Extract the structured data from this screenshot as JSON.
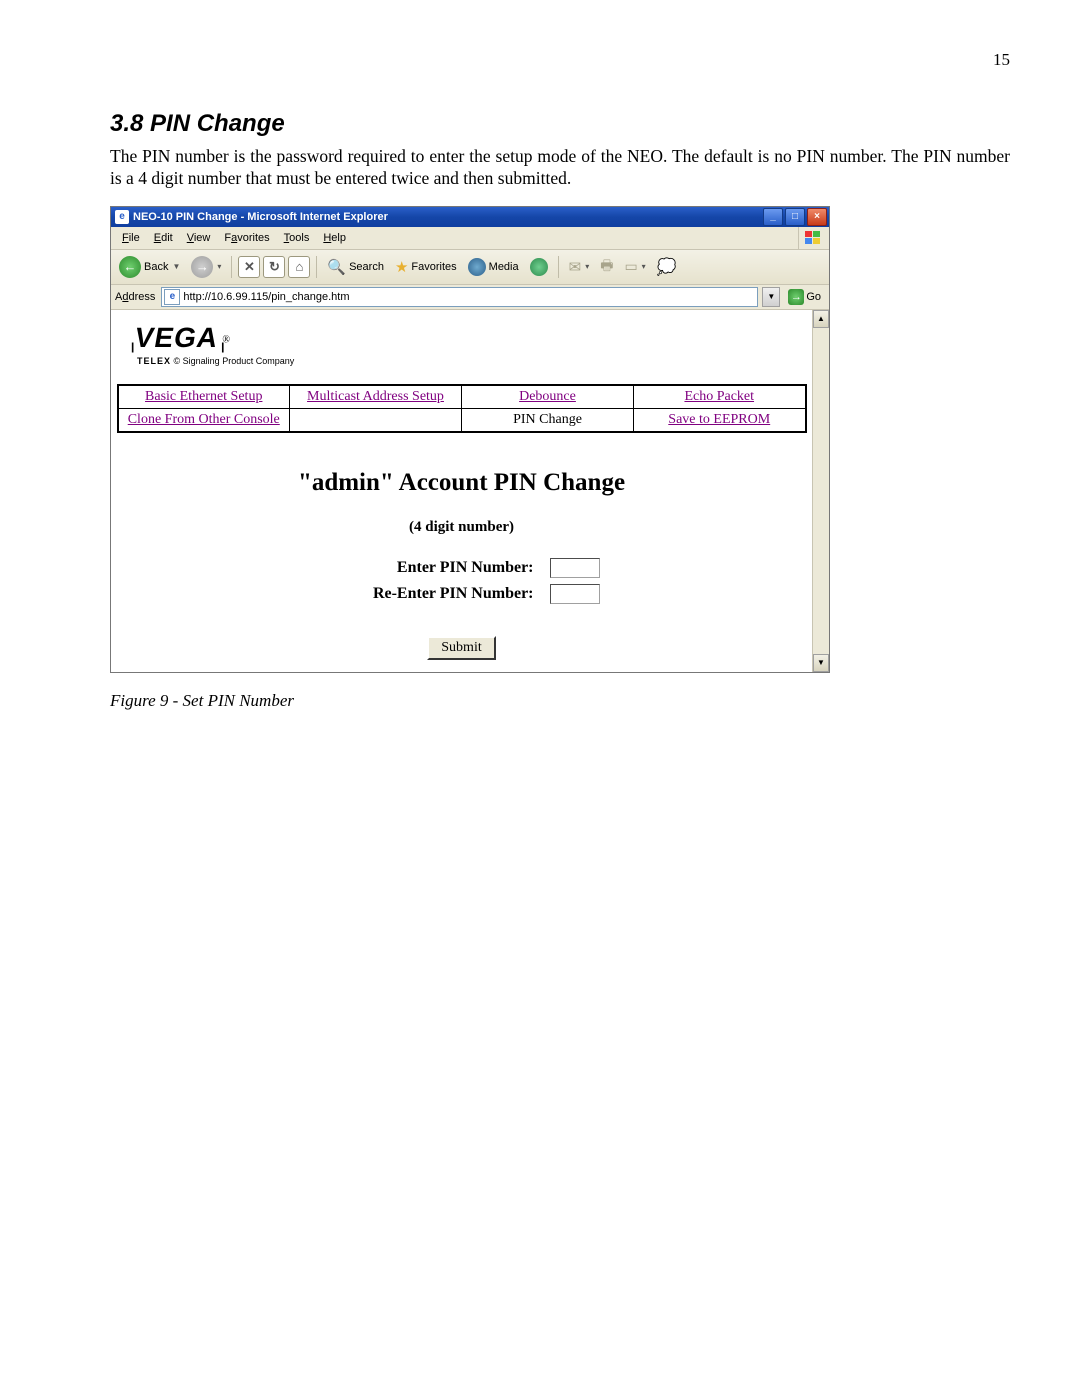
{
  "doc": {
    "page_number": "15",
    "section_heading": "3.8  PIN Change",
    "body_text": "The PIN number is the password required to enter the setup mode of the NEO.  The default is no PIN number.  The PIN number is a 4 digit number that must be entered twice and then submitted.",
    "figure_caption": "Figure 9 - Set PIN Number"
  },
  "window": {
    "title": "NEO-10 PIN Change - Microsoft Internet Explorer",
    "minimize": "_",
    "maximize": "□",
    "close": "×"
  },
  "menubar": {
    "file": "File",
    "edit": "Edit",
    "view": "View",
    "favorites": "Favorites",
    "tools": "Tools",
    "help": "Help"
  },
  "toolbar": {
    "back": "Back",
    "search": "Search",
    "favorites": "Favorites",
    "media": "Media"
  },
  "addressbar": {
    "label": "Address",
    "url": "http://10.6.99.115/pin_change.htm",
    "go": "Go"
  },
  "logo": {
    "brand": "VEGA",
    "subline_brand": "TELEX",
    "subline_rest": "© Signaling Product Company"
  },
  "nav": {
    "r1c1": "Basic Ethernet Setup",
    "r1c2": "Multicast Address Setup",
    "r1c3": "Debounce",
    "r1c4": "Echo Packet",
    "r2c1": "Clone From Other Console",
    "r2c2": "",
    "r2c3": "PIN Change",
    "r2c4": "Save to EEPROM"
  },
  "form": {
    "title": "\"admin\" Account PIN Change",
    "subtitle": "(4 digit number)",
    "enter_label": "Enter PIN Number:",
    "reenter_label": "Re-Enter PIN Number:",
    "submit_label": "Submit"
  }
}
